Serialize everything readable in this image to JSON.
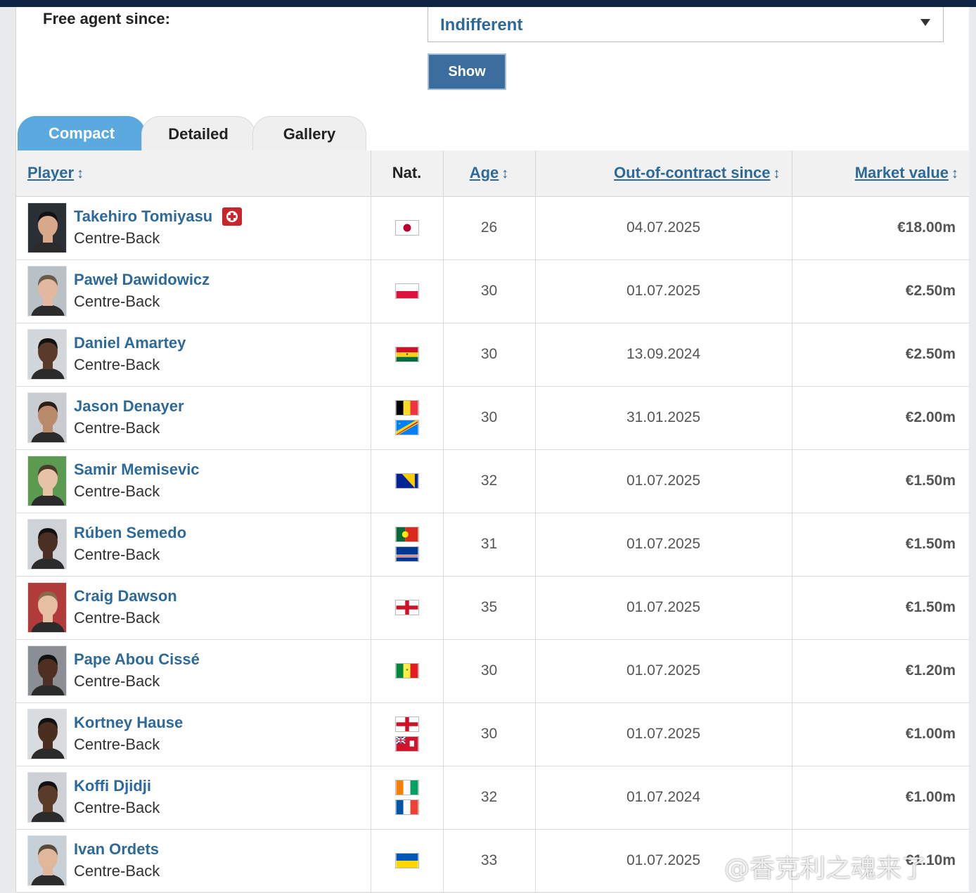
{
  "filter": {
    "label": "Free agent since:",
    "selected": "Indifferent",
    "show_button": "Show"
  },
  "tabs": [
    {
      "label": "Compact",
      "active": true
    },
    {
      "label": "Detailed",
      "active": false
    },
    {
      "label": "Gallery",
      "active": false
    }
  ],
  "table": {
    "headers": {
      "player": "Player",
      "nat": "Nat.",
      "age": "Age",
      "out_of_contract": "Out-of-contract since",
      "market_value": "Market value"
    },
    "rows": [
      {
        "name": "Takehiro Tomiyasu",
        "position": "Centre-Back",
        "injured": true,
        "flags": [
          "japan"
        ],
        "age": "26",
        "since": "04.07.2025",
        "value": "€18.00m"
      },
      {
        "name": "Paweł Dawidowicz",
        "position": "Centre-Back",
        "injured": false,
        "flags": [
          "poland"
        ],
        "age": "30",
        "since": "01.07.2025",
        "value": "€2.50m"
      },
      {
        "name": "Daniel Amartey",
        "position": "Centre-Back",
        "injured": false,
        "flags": [
          "ghana"
        ],
        "age": "30",
        "since": "13.09.2024",
        "value": "€2.50m"
      },
      {
        "name": "Jason Denayer",
        "position": "Centre-Back",
        "injured": false,
        "flags": [
          "belgium",
          "dr-congo"
        ],
        "age": "30",
        "since": "31.01.2025",
        "value": "€2.00m"
      },
      {
        "name": "Samir Memisevic",
        "position": "Centre-Back",
        "injured": false,
        "flags": [
          "bosnia"
        ],
        "age": "32",
        "since": "01.07.2025",
        "value": "€1.50m"
      },
      {
        "name": "Rúben Semedo",
        "position": "Centre-Back",
        "injured": false,
        "flags": [
          "portugal",
          "cape-verde"
        ],
        "age": "31",
        "since": "01.07.2025",
        "value": "€1.50m"
      },
      {
        "name": "Craig Dawson",
        "position": "Centre-Back",
        "injured": false,
        "flags": [
          "england"
        ],
        "age": "35",
        "since": "01.07.2025",
        "value": "€1.50m"
      },
      {
        "name": "Pape Abou Cissé",
        "position": "Centre-Back",
        "injured": false,
        "flags": [
          "senegal"
        ],
        "age": "30",
        "since": "01.07.2025",
        "value": "€1.20m"
      },
      {
        "name": "Kortney Hause",
        "position": "Centre-Back",
        "injured": false,
        "flags": [
          "england",
          "bermuda"
        ],
        "age": "30",
        "since": "01.07.2025",
        "value": "€1.00m"
      },
      {
        "name": "Koffi Djidji",
        "position": "Centre-Back",
        "injured": false,
        "flags": [
          "ivory-coast",
          "france"
        ],
        "age": "32",
        "since": "01.07.2024",
        "value": "€1.00m"
      },
      {
        "name": "Ivan Ordets",
        "position": "Centre-Back",
        "injured": false,
        "flags": [
          "ukraine"
        ],
        "age": "33",
        "since": "01.07.2025",
        "value": "€1.10m"
      }
    ]
  },
  "watermark": "@香克利之魂来了",
  "colors": {
    "link": "#2d6a9a",
    "tab_active": "#5aa9df",
    "button": "#3b6d9f",
    "topbar": "#0e2442"
  }
}
